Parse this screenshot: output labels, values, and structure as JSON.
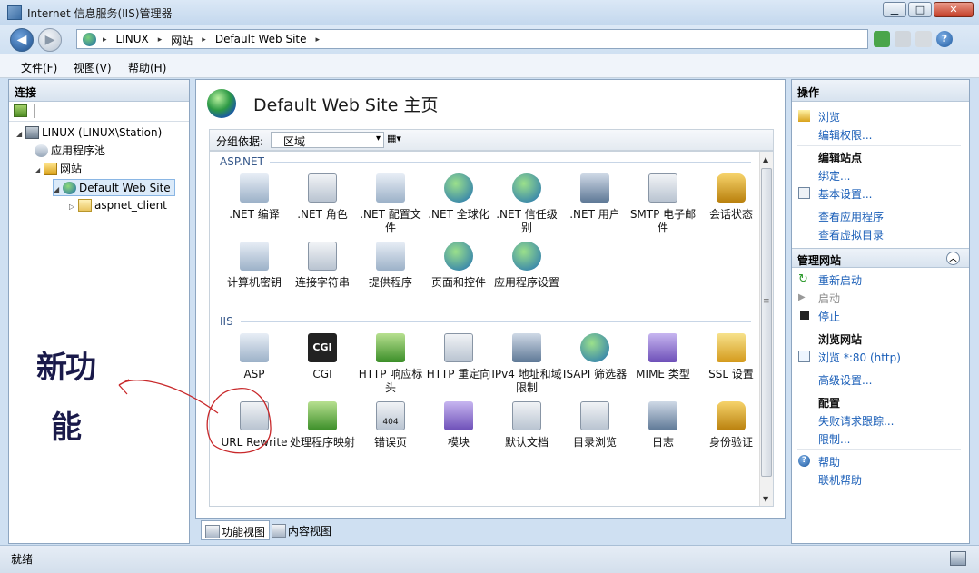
{
  "window": {
    "title": "Internet 信息服务(IIS)管理器",
    "minimize": "▁",
    "maximize": "□",
    "close": "✕"
  },
  "address": {
    "crumbs": [
      "LINUX",
      "网站",
      "Default Web Site"
    ],
    "separator": "▸"
  },
  "menu": {
    "file": "文件(F)",
    "view": "视图(V)",
    "help": "帮助(H)"
  },
  "connections": {
    "header": "连接",
    "tree": [
      {
        "label": "LINUX (LINUX\\Station)",
        "icon": "server-icon"
      },
      {
        "label": "应用程序池",
        "icon": "app-pool-icon"
      },
      {
        "label": "网站",
        "icon": "sites-icon"
      },
      {
        "label": "Default Web Site",
        "icon": "globe-icon",
        "selected": true
      },
      {
        "label": "aspnet_client",
        "icon": "folder-icon"
      }
    ]
  },
  "annotation": {
    "text": "新功能",
    "color": "#c8282a"
  },
  "main": {
    "title": "Default Web Site 主页",
    "group_by_label": "分组依据:",
    "group_by_value": "区域",
    "groups": [
      {
        "name": "ASP.NET",
        "items": [
          {
            "label": ".NET 编译",
            "icon": "net-compile-icon"
          },
          {
            "label": ".NET 角色",
            "icon": "net-roles-icon"
          },
          {
            "label": ".NET 配置文件",
            "icon": "net-profile-icon"
          },
          {
            "label": ".NET 全球化",
            "icon": "net-globalization-icon"
          },
          {
            "label": ".NET 信任级别",
            "icon": "net-trust-icon"
          },
          {
            "label": ".NET 用户",
            "icon": "net-users-icon"
          },
          {
            "label": "SMTP 电子邮件",
            "icon": "smtp-icon"
          },
          {
            "label": "会话状态",
            "icon": "session-icon"
          },
          {
            "label": "计算机密钥",
            "icon": "machine-key-icon"
          },
          {
            "label": "连接字符串",
            "icon": "connection-string-icon"
          },
          {
            "label": "提供程序",
            "icon": "providers-icon"
          },
          {
            "label": "页面和控件",
            "icon": "pages-controls-icon"
          },
          {
            "label": "应用程序设置",
            "icon": "app-settings-icon"
          }
        ]
      },
      {
        "name": "IIS",
        "items": [
          {
            "label": "ASP",
            "icon": "asp-icon"
          },
          {
            "label": "CGI",
            "icon": "cgi-icon"
          },
          {
            "label": "HTTP 响应标头",
            "icon": "http-headers-icon"
          },
          {
            "label": "HTTP 重定向",
            "icon": "http-redirect-icon"
          },
          {
            "label": "IPv4 地址和域限制",
            "icon": "ipv4-icon"
          },
          {
            "label": "ISAPI 筛选器",
            "icon": "isapi-icon"
          },
          {
            "label": "MIME 类型",
            "icon": "mime-icon"
          },
          {
            "label": "SSL 设置",
            "icon": "ssl-icon"
          },
          {
            "label": "URL Rewrite",
            "icon": "url-rewrite-icon"
          },
          {
            "label": "处理程序映射",
            "icon": "handler-icon"
          },
          {
            "label": "错误页",
            "icon": "error-pages-icon",
            "badge": "404"
          },
          {
            "label": "模块",
            "icon": "modules-icon"
          },
          {
            "label": "默认文档",
            "icon": "default-doc-icon"
          },
          {
            "label": "目录浏览",
            "icon": "dir-browse-icon"
          },
          {
            "label": "日志",
            "icon": "logging-icon"
          },
          {
            "label": "身份验证",
            "icon": "auth-icon"
          }
        ]
      }
    ]
  },
  "views": {
    "features": "功能视图",
    "content": "内容视图"
  },
  "actions": {
    "header": "操作",
    "browse": "浏览",
    "edit_permissions": "编辑权限...",
    "edit_site": "编辑站点",
    "bindings": "绑定...",
    "basic_settings": "基本设置...",
    "view_apps": "查看应用程序",
    "view_vdirs": "查看虚拟目录",
    "manage_site": "管理网站",
    "restart": "重新启动",
    "start": "启动",
    "stop": "停止",
    "browse_site": "浏览网站",
    "browse_80": "浏览 *:80 (http)",
    "advanced": "高级设置...",
    "config": "配置",
    "failed_tracing": "失败请求跟踪...",
    "limits": "限制...",
    "help": "帮助",
    "online_help": "联机帮助"
  },
  "status": {
    "text": "就绪"
  }
}
